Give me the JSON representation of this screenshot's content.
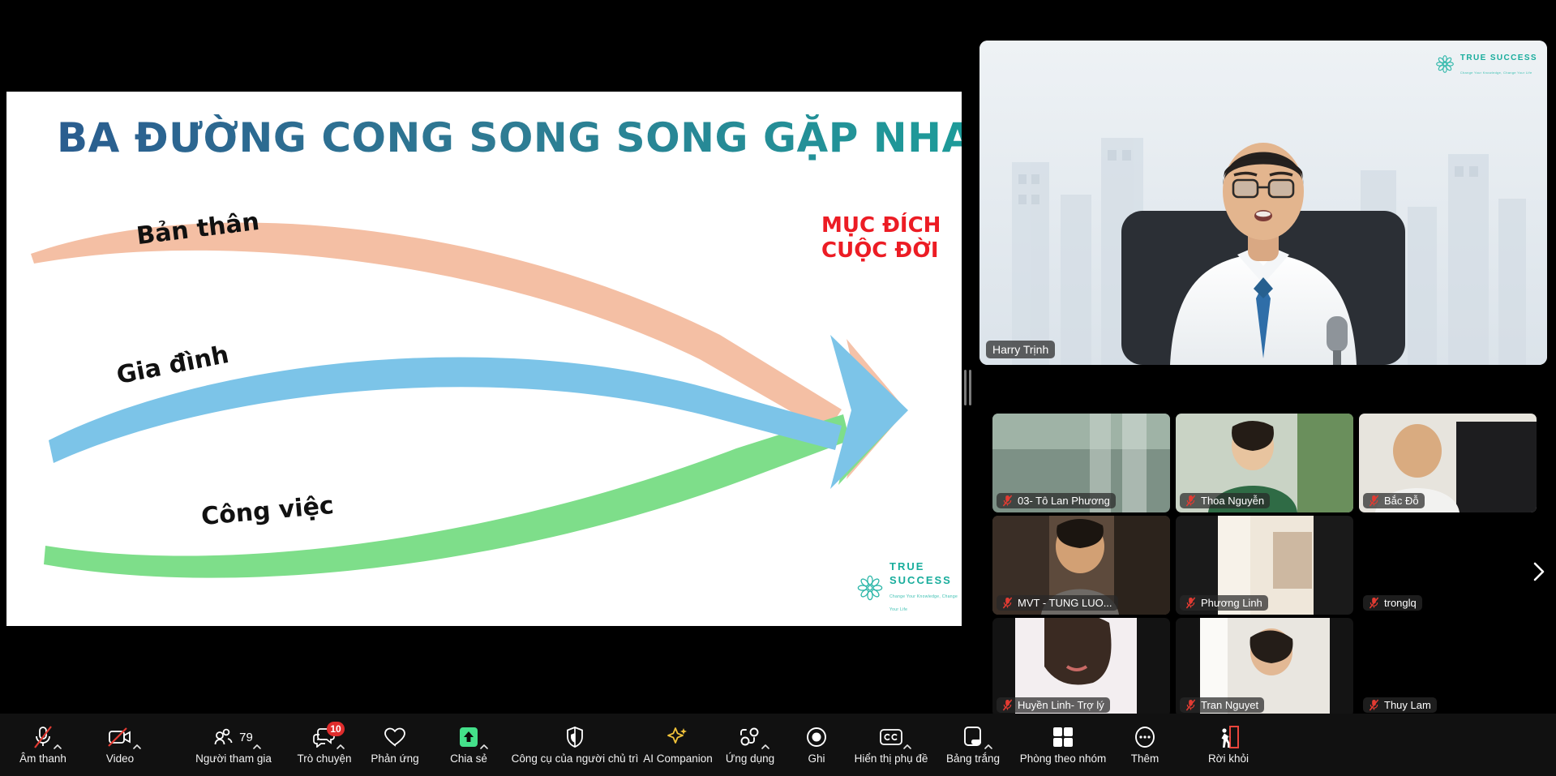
{
  "slide": {
    "title": "BA ĐƯỜNG CONG SONG SONG GẶP NHAU",
    "labels": {
      "ban_than": "Bản thân",
      "gia_dinh": "Gia đình",
      "cong_viec": "Công việc"
    },
    "goal_line1": "MỤC ĐÍCH",
    "goal_line2": "CUỘC ĐỜI",
    "logo": {
      "name": "TRUE SUCCESS",
      "tagline": "Change Your Knowledge, Change Your Life"
    },
    "colors": {
      "curve_self": "#f4bfa4",
      "curve_family": "#7cc4e8",
      "curve_work": "#7ede8a",
      "goal_text": "#ec1c24",
      "title_gradient_start": "#2a5d8f",
      "title_gradient_end": "#1c9e9a",
      "logo_teal": "#18ad9c"
    }
  },
  "video": {
    "main_participant": "Harry Trịnh",
    "logo": {
      "name": "TRUE SUCCESS",
      "tagline": "Change Your Knowledge, Change Your Life"
    },
    "thumbnails": [
      {
        "name": "03- Tô Lan Phương",
        "muted": true
      },
      {
        "name": "Thoa Nguyễn",
        "muted": true
      },
      {
        "name": "Bắc Đỗ",
        "muted": true
      },
      {
        "name": "MVT - TUNG LUO...",
        "muted": true
      },
      {
        "name": "Phương Linh",
        "muted": true
      },
      {
        "name": "tronglq",
        "muted": true
      },
      {
        "name": "Huyền Linh- Trợ lý",
        "muted": true
      },
      {
        "name": "Tran Nguyet",
        "muted": true
      },
      {
        "name": "Thuy Lam",
        "muted": true
      }
    ],
    "next_page_icon": "chevron-right-icon"
  },
  "toolbar": {
    "items": [
      {
        "label": "Âm thanh",
        "icon": "microphone-muted-icon",
        "caret": true,
        "badge": null,
        "count": null
      },
      {
        "label": "Video",
        "icon": "video-camera-off-icon",
        "caret": true,
        "badge": null,
        "count": null
      },
      {
        "label": "Người tham gia",
        "icon": "participants-icon",
        "caret": true,
        "badge": null,
        "count": "79"
      },
      {
        "label": "Trò chuyện",
        "icon": "chat-bubble-icon",
        "caret": true,
        "badge": "10",
        "count": null
      },
      {
        "label": "Phản ứng",
        "icon": "heart-icon",
        "caret": false,
        "badge": null,
        "count": null
      },
      {
        "label": "Chia sẻ",
        "icon": "share-screen-icon",
        "caret": true,
        "badge": null,
        "count": null
      },
      {
        "label": "Công cụ của người chủ trì",
        "icon": "shield-icon",
        "caret": false,
        "badge": null,
        "count": null
      },
      {
        "label": "AI Companion",
        "icon": "sparkle-icon",
        "caret": false,
        "badge": null,
        "count": null
      },
      {
        "label": "Ứng dụng",
        "icon": "apps-icon",
        "caret": true,
        "badge": null,
        "count": null
      },
      {
        "label": "Ghi",
        "icon": "record-icon",
        "caret": false,
        "badge": null,
        "count": null
      },
      {
        "label": "Hiển thị phụ đề",
        "icon": "closed-caption-icon",
        "caret": true,
        "badge": null,
        "count": null
      },
      {
        "label": "Bảng trắng",
        "icon": "whiteboard-icon",
        "caret": true,
        "badge": null,
        "count": null
      },
      {
        "label": "Phòng theo nhóm",
        "icon": "breakout-rooms-icon",
        "caret": false,
        "badge": null,
        "count": null
      },
      {
        "label": "Thêm",
        "icon": "more-ellipsis-icon",
        "caret": false,
        "badge": null,
        "count": null
      },
      {
        "label": "Rời khỏi",
        "icon": "leave-meeting-icon",
        "caret": false,
        "badge": null,
        "count": null
      }
    ],
    "share_active_color": "#44e08a",
    "leave_color": "#e8453c"
  }
}
